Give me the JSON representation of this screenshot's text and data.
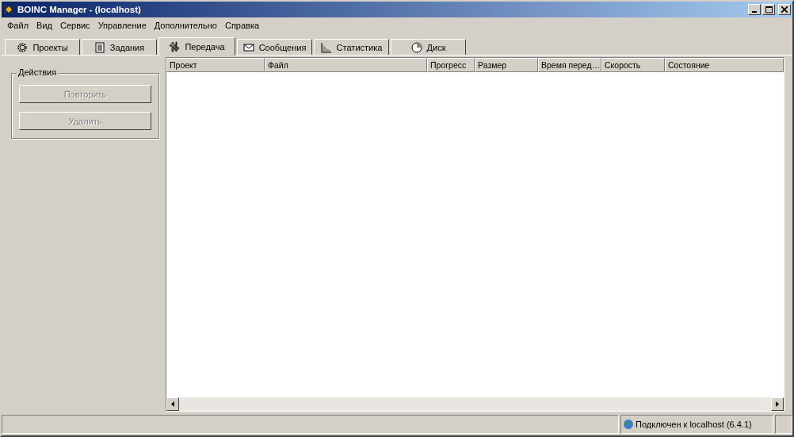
{
  "window": {
    "title": "BOINC Manager - (localhost)"
  },
  "menu": [
    "Файл",
    "Вид",
    "Сервис",
    "Управление",
    "Дополнительно",
    "Справка"
  ],
  "tabs": [
    {
      "label": "Проекты",
      "selected": false
    },
    {
      "label": "Задания",
      "selected": false
    },
    {
      "label": "Передача",
      "selected": true
    },
    {
      "label": "Сообщения",
      "selected": false
    },
    {
      "label": "Статистика",
      "selected": false
    },
    {
      "label": "Диск",
      "selected": false
    }
  ],
  "actions": {
    "title": "Действия",
    "buttons": [
      {
        "label": "Повторить",
        "disabled": true
      },
      {
        "label": "Удалить",
        "disabled": true
      }
    ]
  },
  "table": {
    "columns": [
      "Проект",
      "Файл",
      "Прогресс",
      "Размер",
      "Время перед…",
      "Скорость",
      "Состояние"
    ]
  },
  "status_bar": {
    "text": "Подключен к localhost (6.4.1)"
  }
}
